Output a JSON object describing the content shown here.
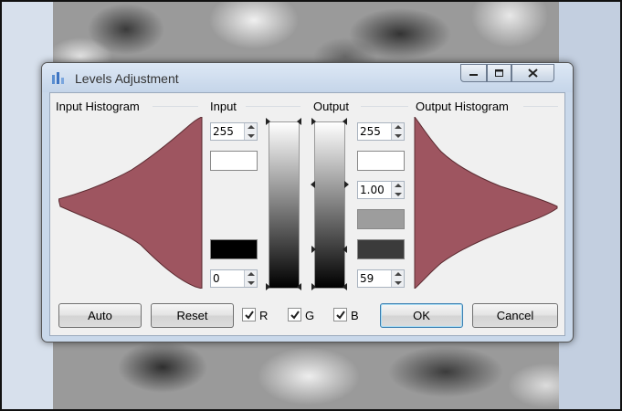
{
  "window": {
    "title": "Levels Adjustment"
  },
  "sections": {
    "input_histogram": "Input Histogram",
    "input": "Input",
    "output": "Output",
    "output_histogram": "Output Histogram"
  },
  "input_fields": {
    "high": "255",
    "low": "0"
  },
  "output_fields": {
    "high": "255",
    "gamma": "1.00",
    "low": "59"
  },
  "colors": {
    "histogram": "#9e5560",
    "input_high_swatch": "#ffffff",
    "input_low_swatch": "#000000",
    "output_gamma_swatch": "#9d9d9d",
    "output_low_swatch": "#3b3b3b",
    "accent": "#3c7fb1"
  },
  "buttons": {
    "auto": "Auto",
    "reset": "Reset",
    "ok": "OK",
    "cancel": "Cancel"
  },
  "channels": [
    {
      "label": "R",
      "checked": true
    },
    {
      "label": "G",
      "checked": true
    },
    {
      "label": "B",
      "checked": true
    }
  ],
  "icons": {
    "title": "levels-chart-icon",
    "minimize": "minimize-icon",
    "maximize": "maximize-icon",
    "close": "close-icon"
  }
}
